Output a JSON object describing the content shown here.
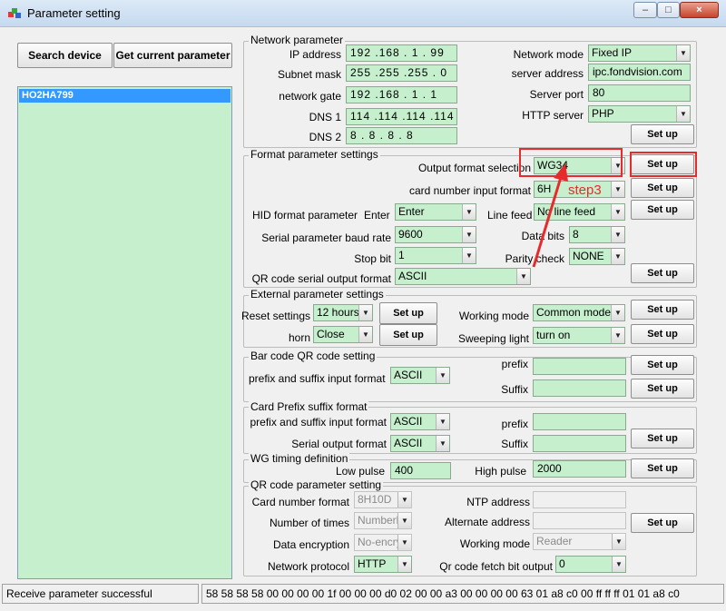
{
  "window": {
    "title": "Parameter setting",
    "controls": {
      "minimize": "–",
      "maximize": "□",
      "close": "×"
    }
  },
  "left": {
    "search_button": "Search device",
    "get_param_button": "Get current parameter",
    "devices": [
      "HO2HA799"
    ]
  },
  "network": {
    "title": "Network parameter",
    "ip_label": "IP address",
    "ip_value": "192 .168 . 1 . 99",
    "subnet_label": "Subnet mask",
    "subnet_value": "255 .255 .255 . 0",
    "gateway_label": "network gate",
    "gateway_value": "192 .168 . 1 . 1",
    "dns1_label": "DNS 1",
    "dns1_value": "114 .114 .114 .114",
    "dns2_label": "DNS 2",
    "dns2_value": "8 . 8 . 8 . 8",
    "mode_label": "Network mode",
    "mode_value": "Fixed IP",
    "server_label": "server address",
    "server_value": "ipc.fondvision.com",
    "port_label": "Server port",
    "port_value": "80",
    "http_label": "HTTP server",
    "http_value": "PHP",
    "setup": "Set up"
  },
  "format": {
    "title": "Format parameter settings",
    "output_label": "Output format selection",
    "output_value": "WG34",
    "card_input_label": "card number input format",
    "card_input_value": "6H",
    "hid_label": "HID format parameter",
    "enter_label": "Enter",
    "enter_value": "Enter",
    "line_feed_label": "Line feed",
    "line_feed_value": "No line feed",
    "baud_label": "Serial parameter baud rate",
    "baud_value": "9600",
    "data_bits_label": "Data bits",
    "data_bits_value": "8",
    "stop_bit_label": "Stop bit",
    "stop_bit_value": "1",
    "parity_label": "Parity check",
    "parity_value": "NONE",
    "qr_serial_label": "QR code serial output format",
    "qr_serial_value": "ASCII",
    "setup": "Set up",
    "annotation": "step3"
  },
  "external": {
    "title": "External parameter settings",
    "reset_label": "Reset settings",
    "reset_value": "12 hours",
    "horn_label": "horn",
    "horn_value": "Close",
    "working_label": "Working mode",
    "working_value": "Common mode",
    "sweeping_label": "Sweeping light",
    "sweeping_value": "turn on",
    "setup": "Set up"
  },
  "barcode": {
    "title": "Bar code QR code setting",
    "ps_label": "prefix and suffix input format",
    "ps_value": "ASCII",
    "prefix_label": "prefix",
    "suffix_label": "Suffix",
    "setup": "Set up"
  },
  "card_prefix": {
    "title": "Card Prefix suffix format",
    "ps_label": "prefix and suffix input format",
    "ps_value": "ASCII",
    "serial_label": "Serial output format",
    "serial_value": "ASCII",
    "prefix_label": "prefix",
    "suffix_label": "Suffix",
    "setup": "Set up"
  },
  "wg": {
    "title": "WG timing definition",
    "low_label": "Low pulse",
    "low_value": "400",
    "high_label": "High pulse",
    "high_value": "2000",
    "setup": "Set up"
  },
  "qr": {
    "title": "QR code parameter setting",
    "card_format_label": "Card number format",
    "card_format_value": "8H10D",
    "times_label": "Number of times",
    "times_value": "Numberl",
    "encryption_label": "Data encryption",
    "encryption_value": "No-encry",
    "protocol_label": "Network protocol",
    "protocol_value": "HTTP",
    "ntp_label": "NTP address",
    "alt_label": "Alternate address",
    "working_label": "Working mode",
    "working_value": "Reader",
    "fetch_label": "Qr code fetch bit output",
    "fetch_value": "0",
    "setup": "Set up"
  },
  "status": {
    "message": "Receive parameter successful",
    "hex": "58 58 58 58 00 00 00 00 1f 00 00 00 d0 02 00 00 a3 00 00 00 00 63 01 a8 c0 00 ff ff ff 01 01 a8 c0"
  },
  "colors": {
    "field_bg": "#c6efce",
    "selection": "#3399ff",
    "highlight": "#e52b2b"
  }
}
